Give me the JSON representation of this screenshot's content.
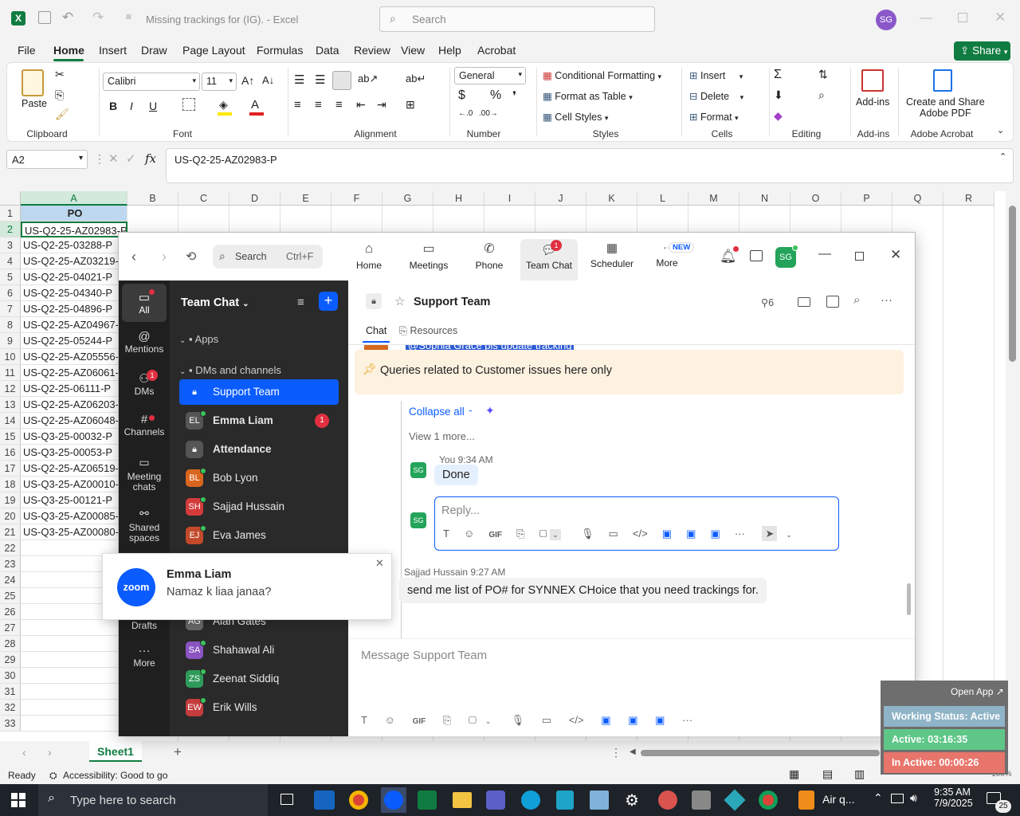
{
  "excel": {
    "title": "Missing trackings for (IG).  -  Excel",
    "search_placeholder": "Search",
    "user_initials": "SG",
    "tabs": [
      "File",
      "Home",
      "Insert",
      "Draw",
      "Page Layout",
      "Formulas",
      "Data",
      "Review",
      "View",
      "Help",
      "Acrobat"
    ],
    "share_label": "Share",
    "ribbon": {
      "paste": "Paste",
      "font_name": "Calibri",
      "font_size": "11",
      "number_format": "General",
      "conditional_formatting": "Conditional Formatting",
      "format_as_table": "Format as Table",
      "cell_styles": "Cell Styles",
      "insert": "Insert",
      "delete": "Delete",
      "format": "Format",
      "addins": "Add-ins",
      "create_share_1": "Create and Share",
      "create_share_2": "Adobe PDF",
      "groups": [
        "Clipboard",
        "Font",
        "Alignment",
        "Number",
        "Styles",
        "Cells",
        "Editing",
        "Add-ins",
        "Adobe Acrobat"
      ]
    },
    "name_box": "A2",
    "formula_value": "US-Q2-25-AZ02983-P",
    "columns": [
      "A",
      "B",
      "C",
      "D",
      "E",
      "F",
      "G",
      "H",
      "I",
      "J",
      "K",
      "L",
      "M",
      "N",
      "O",
      "P",
      "Q",
      "R"
    ],
    "rows": [
      "1",
      "2",
      "3",
      "4",
      "5",
      "6",
      "7",
      "8",
      "9",
      "10",
      "11",
      "12",
      "13",
      "14",
      "15",
      "16",
      "17",
      "18",
      "19",
      "20",
      "21",
      "22",
      "23",
      "24",
      "25",
      "26",
      "27",
      "28",
      "29",
      "30",
      "31",
      "32",
      "33"
    ],
    "column_a": [
      "PO",
      "US-Q2-25-AZ02983-P",
      "US-Q2-25-03288-P",
      "US-Q2-25-AZ03219-",
      "US-Q2-25-04021-P",
      "US-Q2-25-04340-P",
      "US-Q2-25-04896-P",
      "US-Q2-25-AZ04967-",
      "US-Q2-25-05244-P",
      "US-Q2-25-AZ05556-",
      "US-Q2-25-AZ06061-",
      "US-Q2-25-06111-P",
      "US-Q2-25-AZ06203-",
      "US-Q2-25-AZ06048-",
      "US-Q3-25-00032-P",
      "US-Q3-25-00053-P",
      "US-Q2-25-AZ06519-",
      "US-Q3-25-AZ00010-",
      "US-Q3-25-00121-P",
      "US-Q3-25-AZ00085-",
      "US-Q3-25-AZ00080-"
    ],
    "sheet_tab": "Sheet1",
    "status_ready": "Ready",
    "status_accessibility": "Accessibility: Good to go",
    "zoom_level": "100%"
  },
  "zoom": {
    "search_label": "Search",
    "search_shortcut": "Ctrl+F",
    "nav": [
      {
        "label": "Home"
      },
      {
        "label": "Meetings"
      },
      {
        "label": "Phone"
      },
      {
        "label": "Team Chat",
        "badge": "1"
      },
      {
        "label": "Scheduler"
      },
      {
        "label": "More",
        "badge": "NEW"
      }
    ],
    "user_initials": "SG",
    "rail": [
      {
        "label": "All"
      },
      {
        "label": "Mentions"
      },
      {
        "label": "DMs",
        "badge": "1"
      },
      {
        "label": "Channels"
      },
      {
        "label": "Meeting chats"
      },
      {
        "label": "Shared spaces"
      },
      {
        "label": "Drafts"
      },
      {
        "label": "More"
      }
    ],
    "list_title": "Team Chat",
    "sections": {
      "apps": "Apps",
      "dms": "DMs and channels"
    },
    "contacts": [
      {
        "name": "Support Team",
        "initials": "",
        "color": "#0b5cff",
        "selected": true
      },
      {
        "name": "Emma Liam",
        "initials": "EL",
        "color": "#555",
        "bold": true,
        "badge": "1"
      },
      {
        "name": "Attendance",
        "initials": "",
        "color": "#555",
        "bold": true
      },
      {
        "name": "Bob Lyon",
        "initials": "BL",
        "color": "#d9661f"
      },
      {
        "name": "Sajjad Hussain",
        "initials": "SH",
        "color": "#d33b3b"
      },
      {
        "name": "Eva James",
        "initials": "EJ",
        "color": "#c24a2a"
      },
      {
        "name": "Alan Gates",
        "initials": "AG",
        "color": "#666"
      },
      {
        "name": "Shahawal Ali",
        "initials": "SA",
        "color": "#8a54c2"
      },
      {
        "name": "Zeenat Siddiq",
        "initials": "ZS",
        "color": "#2f9b5b"
      },
      {
        "name": "Erik Wills",
        "initials": "EW",
        "color": "#c43c3c"
      }
    ],
    "channel": {
      "name": "Support Team",
      "member_count": "6",
      "tab_chat": "Chat",
      "tab_resources": "Resources",
      "clipped_text": "@Sophia Grace  pls update tracking",
      "pinned": "Queries related to Customer issues here only",
      "collapse_all": "Collapse all",
      "view_more": "View 1 more...",
      "my_msg_sender": "You",
      "my_msg_time": "9:34 AM",
      "my_msg_text": "Done",
      "reply_placeholder": "Reply...",
      "msg2_sender": "Sajjad Hussain",
      "msg2_time": "9:27 AM",
      "msg2_text": "send me list of PO# for SYNNEX CHoice that you need trackings for.",
      "composer_placeholder": "Message Support Team"
    },
    "toast": {
      "brand": "zoom",
      "sender": "Emma Liam",
      "message": "Namaz k liaa janaa?"
    }
  },
  "status_widget": {
    "open_app": "Open App",
    "working": "Working Status: Active",
    "active": "Active: 03:16:35",
    "inactive": "In Active: 00:00:26"
  },
  "taskbar": {
    "search_placeholder": "Type here to search",
    "weather": "Air q...",
    "time": "9:35 AM",
    "date": "7/9/2025",
    "notification_count": "25"
  }
}
